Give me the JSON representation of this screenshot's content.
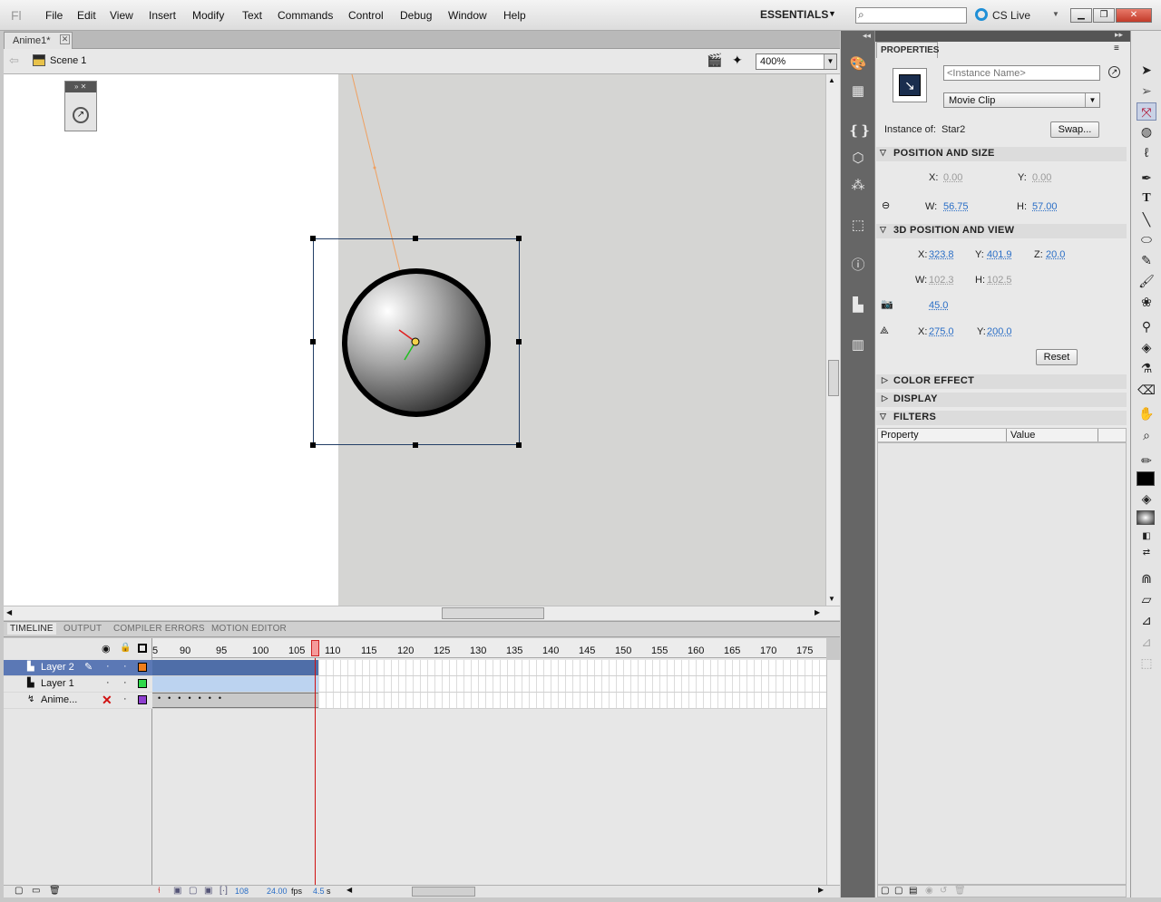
{
  "menubar": {
    "logo": "Fl",
    "items": [
      "File",
      "Edit",
      "View",
      "Insert",
      "Modify",
      "Text",
      "Commands",
      "Control",
      "Debug",
      "Window",
      "Help"
    ],
    "workspace": "ESSENTIALS",
    "search_placeholder": "",
    "cslive": "CS Live"
  },
  "document": {
    "tab_label": "Anime1*",
    "scene_label": "Scene 1",
    "zoom": "400%"
  },
  "timeline": {
    "tabs": [
      "TIMELINE",
      "OUTPUT",
      "COMPILER ERRORS",
      "MOTION EDITOR"
    ],
    "ruler": [
      "5",
      "90",
      "95",
      "100",
      "105",
      "110",
      "115",
      "120",
      "125",
      "130",
      "135",
      "140",
      "145",
      "150",
      "155",
      "160",
      "165",
      "170",
      "175"
    ],
    "layers": [
      {
        "name": "Layer 2",
        "color": "#f07e1a"
      },
      {
        "name": "Layer 1",
        "color": "#2fd94b"
      },
      {
        "name": "Anime...",
        "color": "#8e3fd0"
      }
    ],
    "status": {
      "frame": "108",
      "fps": "24.00",
      "fps_unit": "fps",
      "time": "4.5",
      "time_unit": "s"
    }
  },
  "properties": {
    "tab": "PROPERTIES",
    "instance_name_placeholder": "<Instance Name>",
    "symbol_type": "Movie Clip",
    "instance_of_label": "Instance of:",
    "instance_of": "Star2",
    "swap": "Swap...",
    "position_size": {
      "title": "POSITION AND SIZE",
      "x_label": "X:",
      "x": "0.00",
      "y_label": "Y:",
      "y": "0.00",
      "w_label": "W:",
      "w": "56.75",
      "h_label": "H:",
      "h": "57.00"
    },
    "pos3d": {
      "title": "3D POSITION AND VIEW",
      "x_label": "X:",
      "x": "323.8",
      "y_label": "Y:",
      "y": "401.9",
      "z_label": "Z:",
      "z": "20.0",
      "w_label": "W:",
      "w": "102.3",
      "h_label": "H:",
      "h": "102.5",
      "perspective": "45.0",
      "vx_label": "X:",
      "vx": "275.0",
      "vy_label": "Y:",
      "vy": "200.0",
      "reset": "Reset"
    },
    "color_effect": "COLOR EFFECT",
    "display": "DISPLAY",
    "filters": "FILTERS",
    "filter_cols": [
      "Property",
      "Value"
    ]
  },
  "accent": "#2a6ec6"
}
